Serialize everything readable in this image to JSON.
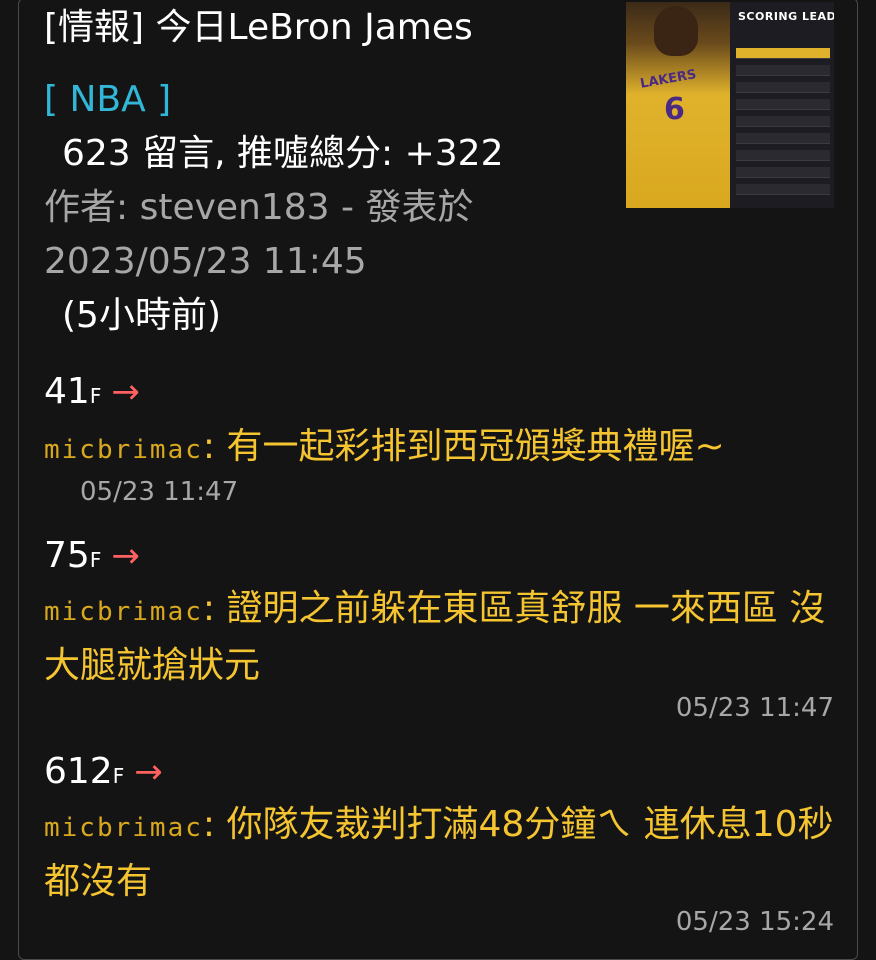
{
  "post": {
    "title": "[情報] 今日LeBron James",
    "board": "[ NBA ]",
    "stats": "623 留言, 推噓總分: +322",
    "author_line": "作者: steven183 - 發表於",
    "datetime": "2023/05/23 11:45",
    "ago": "(5小時前)"
  },
  "thumbnail": {
    "panel_title": "SCORING LEADERS",
    "jersey_text": "LAKERS",
    "jersey_number": "6",
    "icon": "article-thumbnail-image"
  },
  "comments": [
    {
      "floor": "41",
      "floor_suffix": "F",
      "arrow": "→",
      "user": "micbrimac",
      "text": ": 有一起彩排到西冠頒獎典禮喔~",
      "time": "05/23 11:47"
    },
    {
      "floor": "75",
      "floor_suffix": "F",
      "arrow": "→",
      "user": "micbrimac",
      "text": ": 證明之前躲在東區真舒服 一來西區 沒大腿就搶狀元",
      "time": "05/23 11:47"
    },
    {
      "floor": "612",
      "floor_suffix": "F",
      "arrow": "→",
      "user": "micbrimac",
      "text": ": 你隊友裁判打滿48分鐘ㄟ 連休息10秒都沒有",
      "time": "05/23 15:24"
    }
  ],
  "colors": {
    "background": "#141414",
    "board": "#33b7d9",
    "comment_text": "#f4c431",
    "arrow": "#ff6161",
    "muted": "#a7a7a7"
  }
}
